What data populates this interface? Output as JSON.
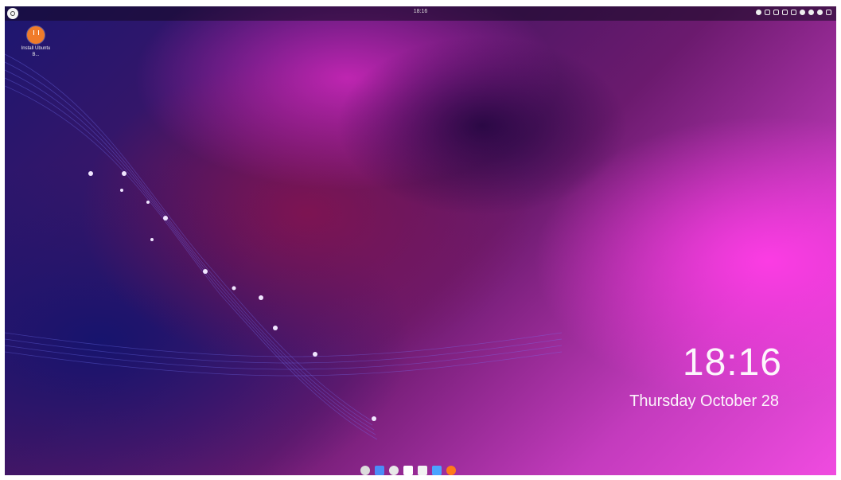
{
  "topbar": {
    "clock": "18:16"
  },
  "desktop": {
    "install_icon_label": "Install Ubuntu B..."
  },
  "lockclock": {
    "time": "18:16",
    "date": "Thursday October 28"
  },
  "dock": {
    "items": [
      {
        "name": "settings-icon",
        "color": "#dcdcdc"
      },
      {
        "name": "text-editor-icon",
        "color": "#4b8df8"
      },
      {
        "name": "software-icon",
        "color": "#e8e8e8"
      },
      {
        "name": "document-icon",
        "color": "#ffffff"
      },
      {
        "name": "files-icon",
        "color": "#f2f2f2"
      },
      {
        "name": "folder-icon",
        "color": "#4aa3ff"
      },
      {
        "name": "firefox-icon",
        "color": "#ff7a1a"
      }
    ]
  }
}
